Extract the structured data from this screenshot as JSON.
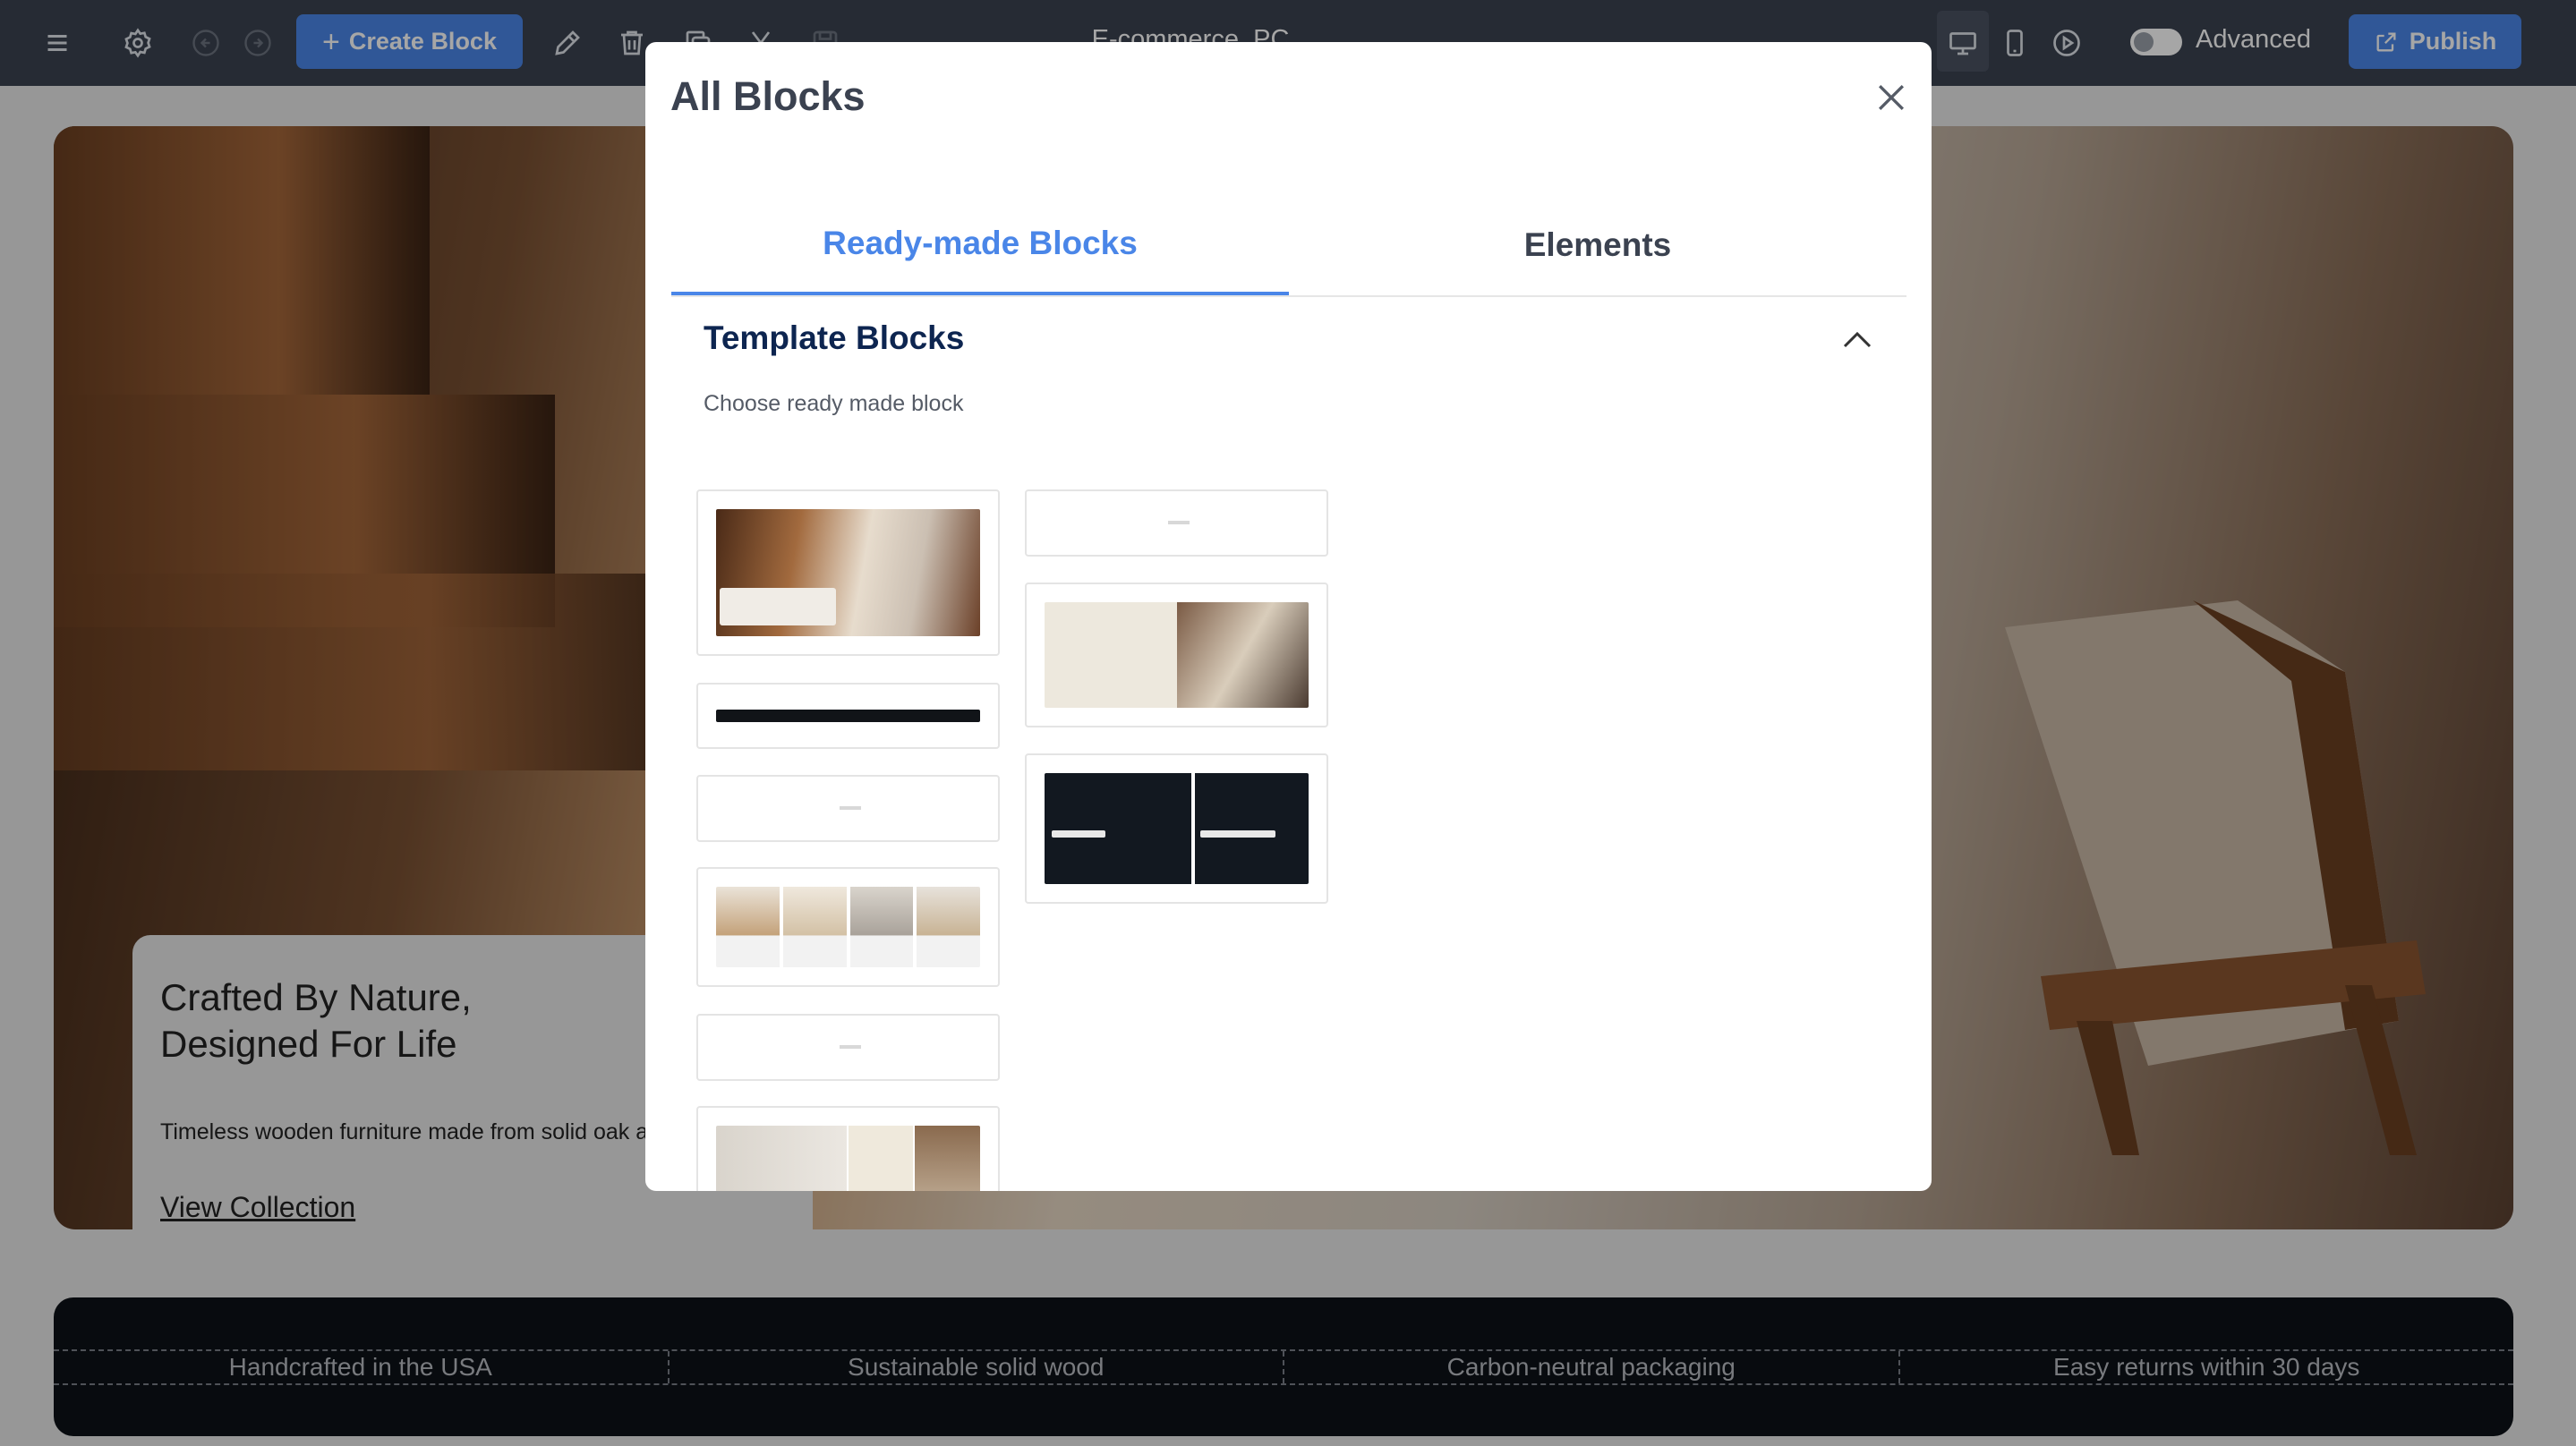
{
  "toolbar": {
    "create_block_label": "Create Block",
    "document_title": "E-commerce_PC",
    "advanced_label": "Advanced",
    "publish_label": "Publish"
  },
  "hero": {
    "title_line1": "Crafted By Nature,",
    "title_line2": "Designed For Life",
    "description": "Timeless wooden furniture made from solid oak and w",
    "link": "View Collection"
  },
  "features_strip": {
    "items": [
      "Handcrafted in the USA",
      "Sustainable solid wood",
      "Carbon-neutral packaging",
      "Easy returns within 30 days"
    ]
  },
  "modal": {
    "title": "All Blocks",
    "tabs": [
      {
        "label": "Ready-made Blocks",
        "active": true
      },
      {
        "label": "Elements",
        "active": false
      }
    ],
    "section": {
      "title": "Template Blocks",
      "subtitle": "Choose ready made block"
    }
  },
  "colors": {
    "toolbar_bg": "#3b4250",
    "accent": "#4a86e8",
    "section_title": "#0d2550",
    "strip_bg": "#0d1117"
  }
}
